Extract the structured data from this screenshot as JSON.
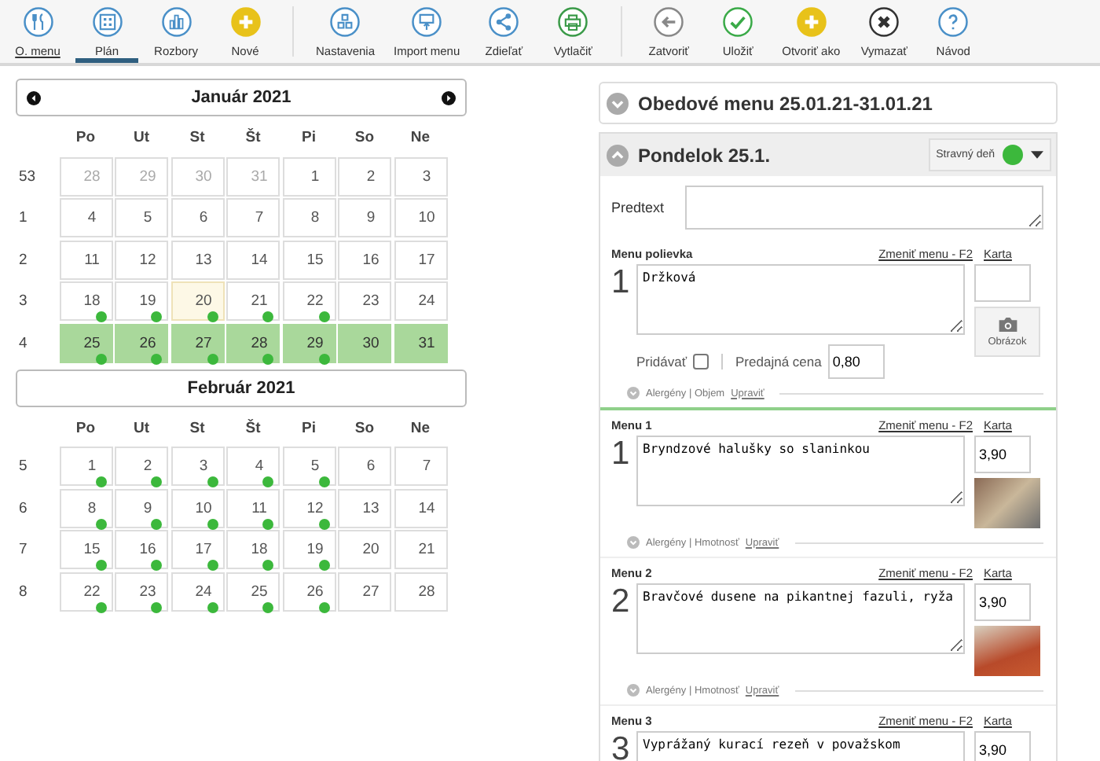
{
  "toolbar": {
    "groups": [
      [
        {
          "label": "O. menu",
          "kind": "menu",
          "selected": false,
          "link": true
        },
        {
          "label": "Plán",
          "kind": "plan",
          "selected": true,
          "link": false
        },
        {
          "label": "Rozbory",
          "kind": "analysis",
          "selected": false,
          "link": false
        },
        {
          "label": "Nové",
          "kind": "new",
          "selected": false,
          "link": false
        }
      ],
      [
        {
          "label": "Nastavenia",
          "kind": "settings",
          "selected": false,
          "link": false
        },
        {
          "label": "Import menu",
          "kind": "import",
          "selected": false,
          "link": false
        },
        {
          "label": "Zdieľať",
          "kind": "share",
          "selected": false,
          "link": false
        },
        {
          "label": "Vytlačiť",
          "kind": "print",
          "selected": false,
          "link": false
        }
      ],
      [
        {
          "label": "Zatvoriť",
          "kind": "close",
          "selected": false,
          "link": false
        },
        {
          "label": "Uložiť",
          "kind": "save",
          "selected": false,
          "link": false
        },
        {
          "label": "Otvoriť ako",
          "kind": "new",
          "selected": false,
          "link": false
        },
        {
          "label": "Vymazať",
          "kind": "delete",
          "selected": false,
          "link": false
        },
        {
          "label": "Návod",
          "kind": "help",
          "selected": false,
          "link": false
        }
      ]
    ]
  },
  "calendars": [
    {
      "title": "Január 2021",
      "nav": true,
      "weekdays": [
        "Po",
        "Ut",
        "St",
        "Št",
        "Pi",
        "So",
        "Ne"
      ],
      "weeks": [
        {
          "number": "53",
          "days": [
            {
              "day": "28",
              "other_month": true,
              "dot": false,
              "selected": false,
              "today": false
            },
            {
              "day": "29",
              "other_month": true,
              "dot": false,
              "selected": false,
              "today": false
            },
            {
              "day": "30",
              "other_month": true,
              "dot": false,
              "selected": false,
              "today": false
            },
            {
              "day": "31",
              "other_month": true,
              "dot": false,
              "selected": false,
              "today": false
            },
            {
              "day": "1",
              "other_month": false,
              "dot": false,
              "selected": false,
              "today": false
            },
            {
              "day": "2",
              "other_month": false,
              "dot": false,
              "selected": false,
              "today": false
            },
            {
              "day": "3",
              "other_month": false,
              "dot": false,
              "selected": false,
              "today": false
            }
          ]
        },
        {
          "number": "1",
          "days": [
            {
              "day": "4",
              "other_month": false,
              "dot": false,
              "selected": false,
              "today": false
            },
            {
              "day": "5",
              "other_month": false,
              "dot": false,
              "selected": false,
              "today": false
            },
            {
              "day": "6",
              "other_month": false,
              "dot": false,
              "selected": false,
              "today": false
            },
            {
              "day": "7",
              "other_month": false,
              "dot": false,
              "selected": false,
              "today": false
            },
            {
              "day": "8",
              "other_month": false,
              "dot": false,
              "selected": false,
              "today": false
            },
            {
              "day": "9",
              "other_month": false,
              "dot": false,
              "selected": false,
              "today": false
            },
            {
              "day": "10",
              "other_month": false,
              "dot": false,
              "selected": false,
              "today": false
            }
          ]
        },
        {
          "number": "2",
          "days": [
            {
              "day": "11",
              "other_month": false,
              "dot": false,
              "selected": false,
              "today": false
            },
            {
              "day": "12",
              "other_month": false,
              "dot": false,
              "selected": false,
              "today": false
            },
            {
              "day": "13",
              "other_month": false,
              "dot": false,
              "selected": false,
              "today": false
            },
            {
              "day": "14",
              "other_month": false,
              "dot": false,
              "selected": false,
              "today": false
            },
            {
              "day": "15",
              "other_month": false,
              "dot": false,
              "selected": false,
              "today": false
            },
            {
              "day": "16",
              "other_month": false,
              "dot": false,
              "selected": false,
              "today": false
            },
            {
              "day": "17",
              "other_month": false,
              "dot": false,
              "selected": false,
              "today": false
            }
          ]
        },
        {
          "number": "3",
          "days": [
            {
              "day": "18",
              "other_month": false,
              "dot": true,
              "selected": false,
              "today": false
            },
            {
              "day": "19",
              "other_month": false,
              "dot": true,
              "selected": false,
              "today": false
            },
            {
              "day": "20",
              "other_month": false,
              "dot": true,
              "selected": false,
              "today": true
            },
            {
              "day": "21",
              "other_month": false,
              "dot": true,
              "selected": false,
              "today": false
            },
            {
              "day": "22",
              "other_month": false,
              "dot": true,
              "selected": false,
              "today": false
            },
            {
              "day": "23",
              "other_month": false,
              "dot": false,
              "selected": false,
              "today": false
            },
            {
              "day": "24",
              "other_month": false,
              "dot": false,
              "selected": false,
              "today": false
            }
          ]
        },
        {
          "number": "4",
          "days": [
            {
              "day": "25",
              "other_month": false,
              "dot": true,
              "selected": true,
              "today": false
            },
            {
              "day": "26",
              "other_month": false,
              "dot": true,
              "selected": true,
              "today": false
            },
            {
              "day": "27",
              "other_month": false,
              "dot": true,
              "selected": true,
              "today": false
            },
            {
              "day": "28",
              "other_month": false,
              "dot": true,
              "selected": true,
              "today": false
            },
            {
              "day": "29",
              "other_month": false,
              "dot": true,
              "selected": true,
              "today": false
            },
            {
              "day": "30",
              "other_month": false,
              "dot": false,
              "selected": true,
              "today": false
            },
            {
              "day": "31",
              "other_month": false,
              "dot": false,
              "selected": true,
              "today": false
            }
          ]
        }
      ]
    },
    {
      "title": "Február 2021",
      "nav": false,
      "weekdays": [
        "Po",
        "Ut",
        "St",
        "Št",
        "Pi",
        "So",
        "Ne"
      ],
      "weeks": [
        {
          "number": "5",
          "days": [
            {
              "day": "1",
              "other_month": false,
              "dot": true,
              "selected": false,
              "today": false
            },
            {
              "day": "2",
              "other_month": false,
              "dot": true,
              "selected": false,
              "today": false
            },
            {
              "day": "3",
              "other_month": false,
              "dot": true,
              "selected": false,
              "today": false
            },
            {
              "day": "4",
              "other_month": false,
              "dot": true,
              "selected": false,
              "today": false
            },
            {
              "day": "5",
              "other_month": false,
              "dot": true,
              "selected": false,
              "today": false
            },
            {
              "day": "6",
              "other_month": false,
              "dot": false,
              "selected": false,
              "today": false
            },
            {
              "day": "7",
              "other_month": false,
              "dot": false,
              "selected": false,
              "today": false
            }
          ]
        },
        {
          "number": "6",
          "days": [
            {
              "day": "8",
              "other_month": false,
              "dot": true,
              "selected": false,
              "today": false
            },
            {
              "day": "9",
              "other_month": false,
              "dot": true,
              "selected": false,
              "today": false
            },
            {
              "day": "10",
              "other_month": false,
              "dot": true,
              "selected": false,
              "today": false
            },
            {
              "day": "11",
              "other_month": false,
              "dot": true,
              "selected": false,
              "today": false
            },
            {
              "day": "12",
              "other_month": false,
              "dot": true,
              "selected": false,
              "today": false
            },
            {
              "day": "13",
              "other_month": false,
              "dot": false,
              "selected": false,
              "today": false
            },
            {
              "day": "14",
              "other_month": false,
              "dot": false,
              "selected": false,
              "today": false
            }
          ]
        },
        {
          "number": "7",
          "days": [
            {
              "day": "15",
              "other_month": false,
              "dot": true,
              "selected": false,
              "today": false
            },
            {
              "day": "16",
              "other_month": false,
              "dot": true,
              "selected": false,
              "today": false
            },
            {
              "day": "17",
              "other_month": false,
              "dot": true,
              "selected": false,
              "today": false
            },
            {
              "day": "18",
              "other_month": false,
              "dot": true,
              "selected": false,
              "today": false
            },
            {
              "day": "19",
              "other_month": false,
              "dot": true,
              "selected": false,
              "today": false
            },
            {
              "day": "20",
              "other_month": false,
              "dot": false,
              "selected": false,
              "today": false
            },
            {
              "day": "21",
              "other_month": false,
              "dot": false,
              "selected": false,
              "today": false
            }
          ]
        },
        {
          "number": "8",
          "days": [
            {
              "day": "22",
              "other_month": false,
              "dot": true,
              "selected": false,
              "today": false
            },
            {
              "day": "23",
              "other_month": false,
              "dot": true,
              "selected": false,
              "today": false
            },
            {
              "day": "24",
              "other_month": false,
              "dot": true,
              "selected": false,
              "today": false
            },
            {
              "day": "25",
              "other_month": false,
              "dot": true,
              "selected": false,
              "today": false
            },
            {
              "day": "26",
              "other_month": false,
              "dot": true,
              "selected": false,
              "today": false
            },
            {
              "day": "27",
              "other_month": false,
              "dot": false,
              "selected": false,
              "today": false
            },
            {
              "day": "28",
              "other_month": false,
              "dot": false,
              "selected": false,
              "today": false
            }
          ]
        }
      ]
    }
  ],
  "menu_panel": {
    "title": "Obedové menu 25.01.21-31.01.21",
    "expanded": false,
    "day": {
      "title": "Pondelok 25.1.",
      "expanded": true,
      "day_type": {
        "label": "Stravný deň",
        "color": "#3cb83c"
      },
      "pretext": {
        "label": "Predtext"
      },
      "items": [
        {
          "kind": "soup",
          "heading": "Menu polievka",
          "number": "1",
          "text": "Držková",
          "change_link": "Zmeniť menu - F2",
          "card_link": "Karta",
          "add_label": "Pridávať",
          "add_checked": false,
          "price_label": "Predajná cena",
          "price": "0,80",
          "image_button": "Obrázok",
          "info": "Alergény | Objem",
          "edit_link": "Upraviť"
        },
        {
          "kind": "dish",
          "heading": "Menu 1",
          "number": "1",
          "text": "Bryndzové halušky so slaninkou",
          "change_link": "Zmeniť menu - F2",
          "card_link": "Karta",
          "price": "3,90",
          "info": "Alergény | Hmotnosť",
          "edit_link": "Upraviť"
        },
        {
          "kind": "dish",
          "heading": "Menu 2",
          "number": "2",
          "text": "Bravčové dusene na pikantnej fazuli, ryža",
          "change_link": "Zmeniť menu - F2",
          "card_link": "Karta",
          "price": "3,90",
          "info": "Alergény | Hmotnosť",
          "edit_link": "Upraviť"
        },
        {
          "kind": "dish",
          "heading": "Menu 3",
          "number": "3",
          "text": "Vyprážaný kurací rezeň v považskom",
          "change_link": "Zmeniť menu - F2",
          "card_link": "Karta",
          "price": "3,90"
        }
      ]
    }
  }
}
